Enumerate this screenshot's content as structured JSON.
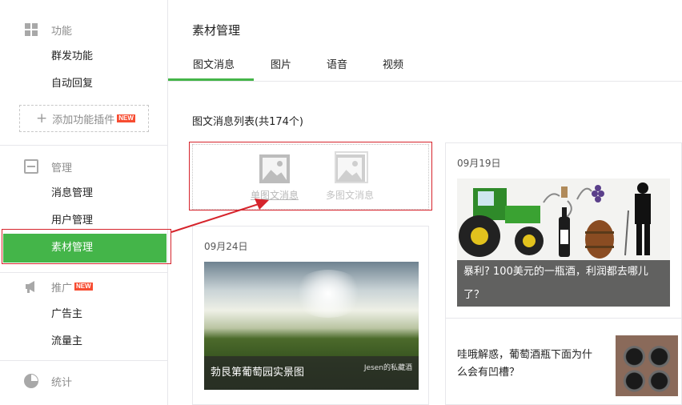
{
  "sidebar": {
    "sections": [
      {
        "label": "功能",
        "items": [
          "群发功能",
          "自动回复"
        ]
      },
      {
        "label": "管理",
        "items": [
          "消息管理",
          "用户管理",
          "素材管理"
        ]
      },
      {
        "label": "推广",
        "items": [
          "广告主",
          "流量主"
        ]
      },
      {
        "label": "统计",
        "items": []
      }
    ],
    "add_plugin": "添加功能插件",
    "new_badge": "NEW"
  },
  "main": {
    "title": "素材管理",
    "tabs": [
      "图文消息",
      "图片",
      "语音",
      "视频"
    ],
    "list_title": "图文消息列表(共174个)",
    "create": {
      "single": "单图文消息",
      "multi": "多图文消息"
    },
    "cards": [
      {
        "date": "09月24日",
        "caption": "勃艮第葡萄园实景图",
        "watermark": "Jesen的私藏酒"
      },
      {
        "date": "09月19日",
        "caption": "暴利? 100美元的一瓶酒，利润都去哪儿了？",
        "second_title": "哇哦解惑，葡萄酒瓶下面为什么会有凹槽？"
      }
    ]
  },
  "colors": {
    "accent": "#44b549",
    "annotation": "#d6242c",
    "badge": "#f74c31"
  }
}
